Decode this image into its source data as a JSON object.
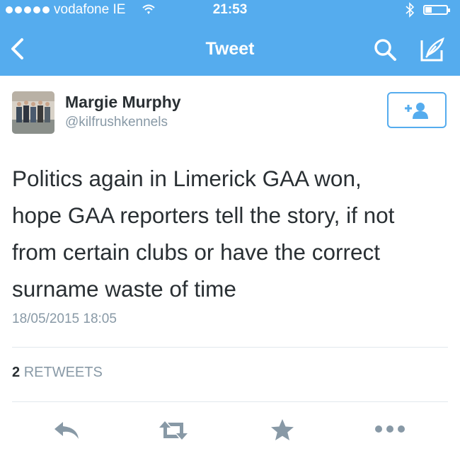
{
  "status_bar": {
    "carrier": "vodafone IE",
    "time": "21:53"
  },
  "nav": {
    "title": "Tweet",
    "icons": [
      "back-chevron-icon",
      "search-icon",
      "compose-icon"
    ]
  },
  "tweet": {
    "author_name": "Margie Murphy",
    "author_handle": "@kilfrushkennels",
    "text_lines": [
      "Politics again in Limerick GAA won,",
      "hope GAA reporters tell the story, if not",
      "from certain clubs or have the correct",
      "surname waste of time"
    ],
    "timestamp": "18/05/2015 18:05",
    "retweet_count": "2",
    "retweet_label": "RETWEETS"
  },
  "actions": [
    "reply-icon",
    "retweet-icon",
    "favorite-icon",
    "more-icon"
  ],
  "colors": {
    "brand": "#55acee",
    "text": "#292f33",
    "muted": "#8899a6",
    "action": "#8899a6",
    "divider": "#e1e8ed"
  }
}
